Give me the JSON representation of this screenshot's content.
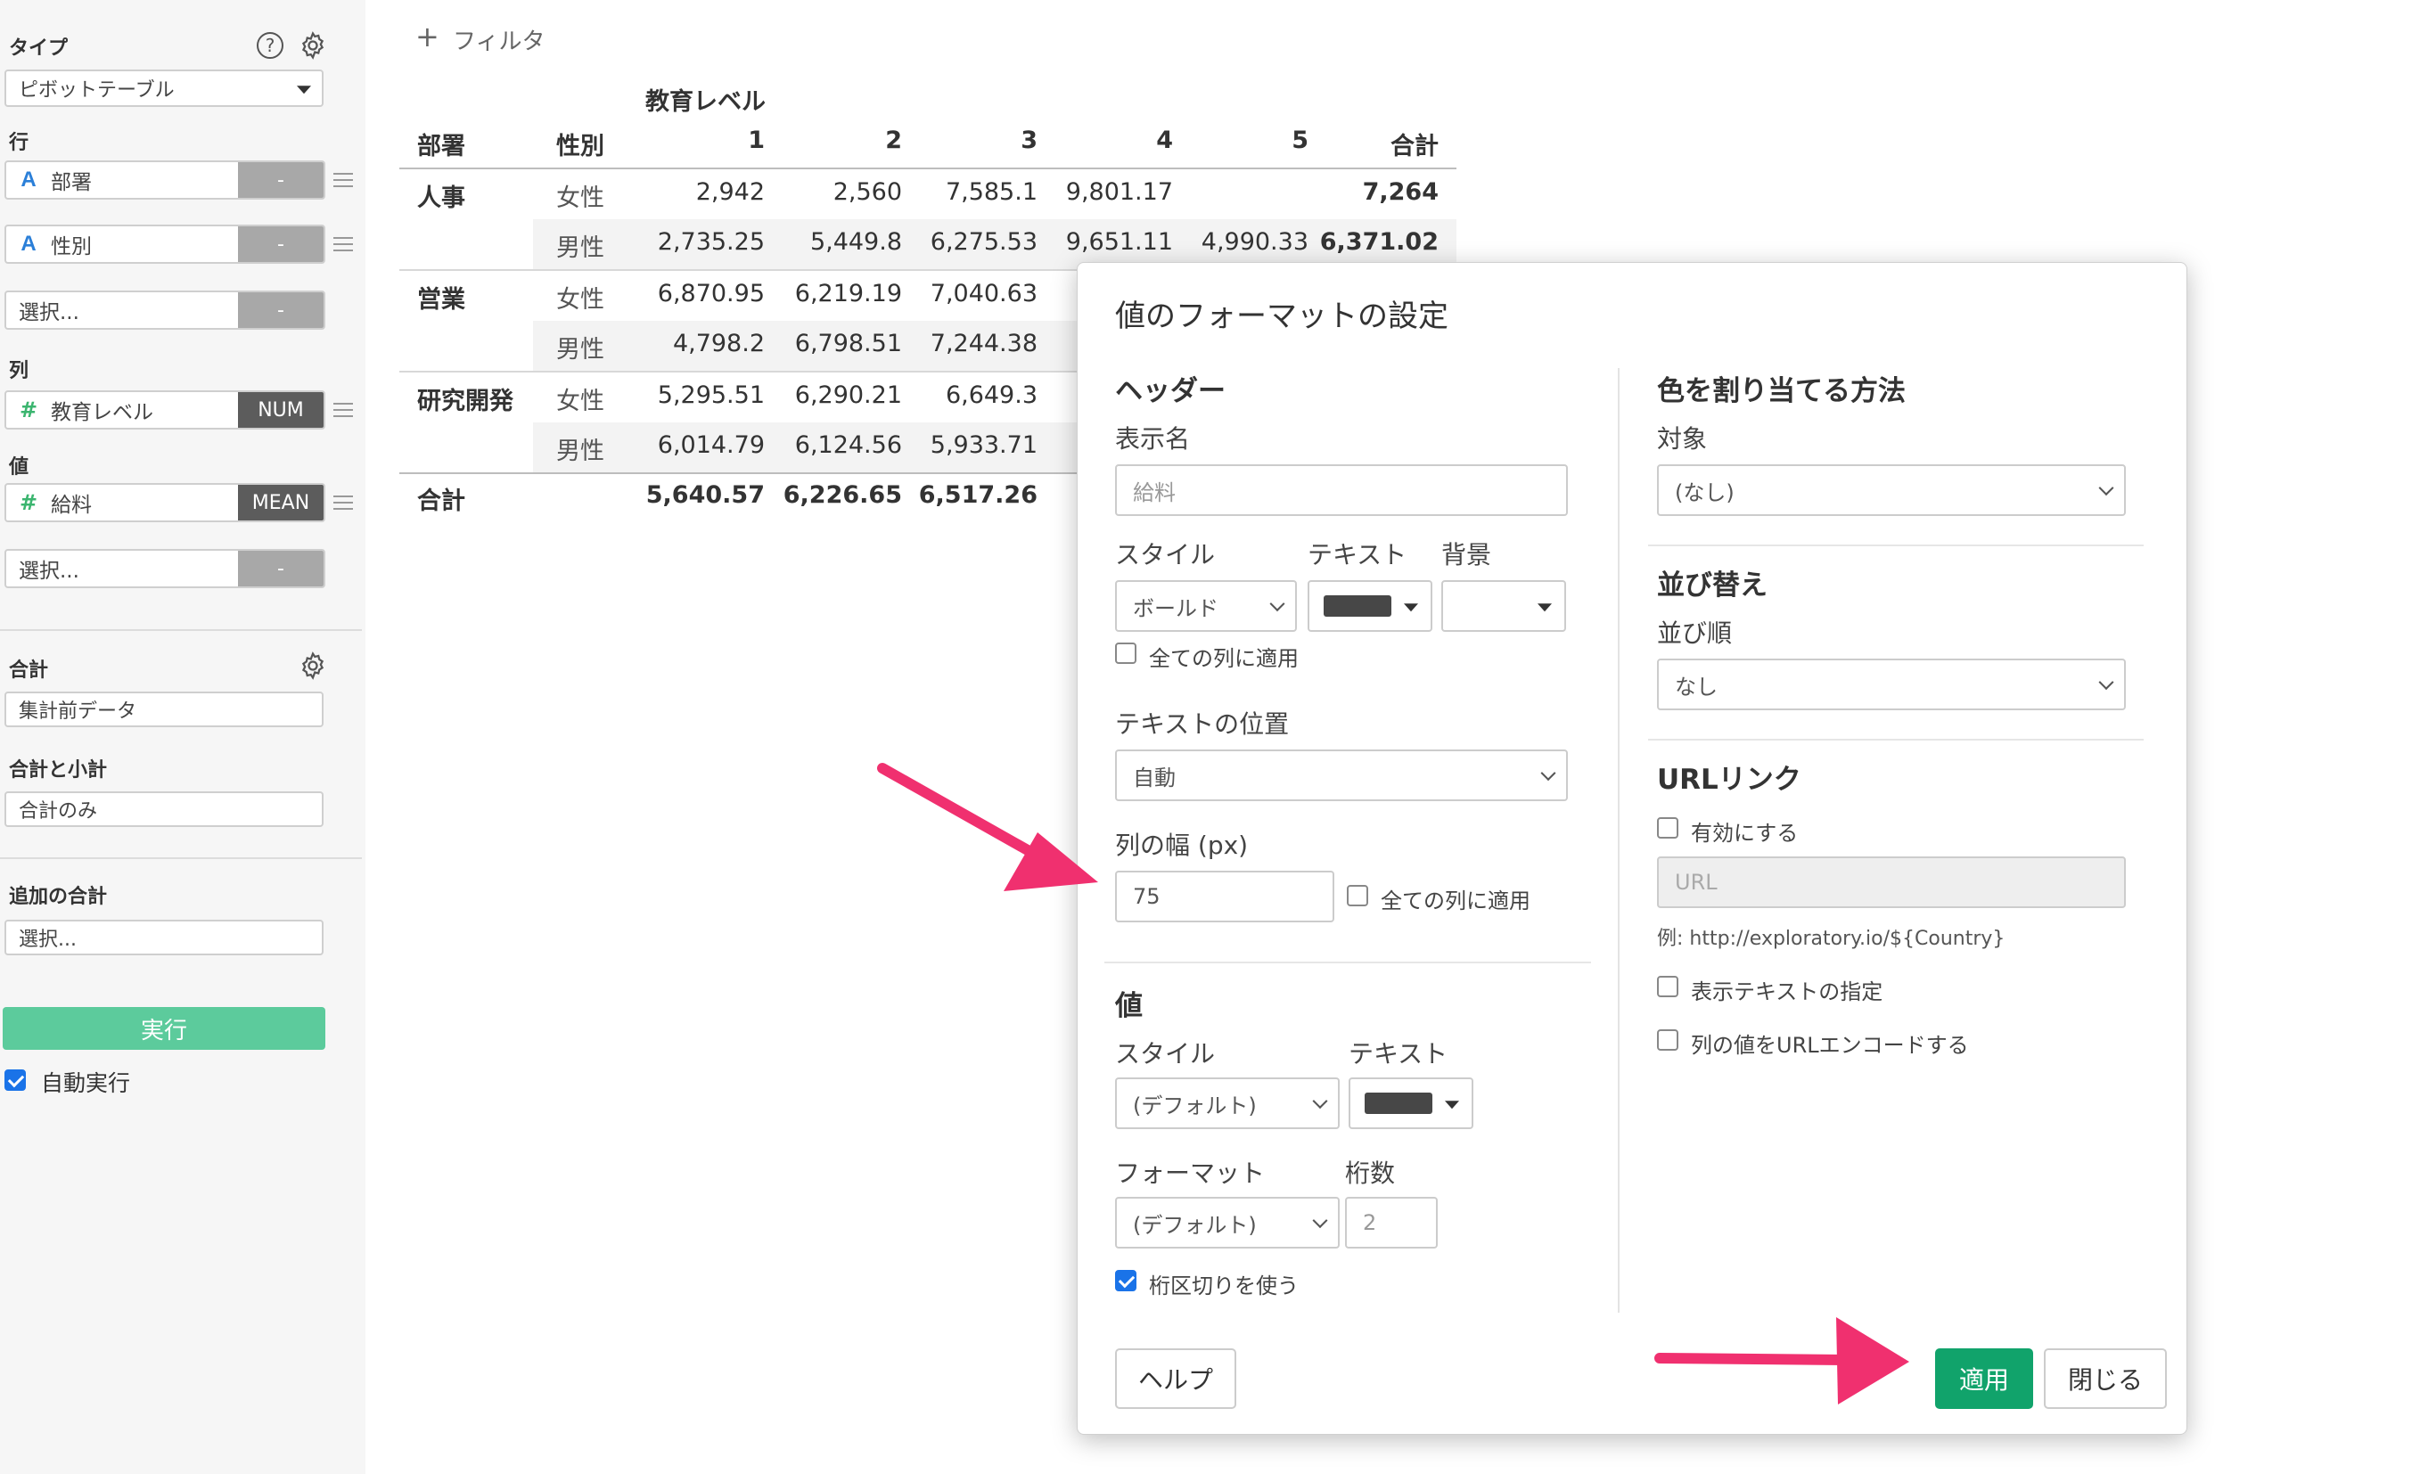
{
  "colors": {
    "accent_green": "#11a36b",
    "run_button": "#5ccb9c",
    "arrow": "#f0306f",
    "checkbox_blue": "#1a73e8"
  },
  "sidebar": {
    "type_label": "タイプ",
    "type_value": "ピボットテーブル",
    "rows_label": "行",
    "rows": [
      {
        "icon": "A",
        "name": "部署",
        "agg": "-"
      },
      {
        "icon": "A",
        "name": "性別",
        "agg": "-"
      }
    ],
    "rows_select": "選択...",
    "rows_select_agg": "-",
    "cols_label": "列",
    "col_field": {
      "icon": "#",
      "name": "教育レベル",
      "agg": "NUM"
    },
    "values_label": "値",
    "value_field": {
      "icon": "#",
      "name": "給料",
      "agg": "MEAN"
    },
    "values_select": "選択...",
    "values_select_agg": "-",
    "total_label": "合計",
    "total_value": "集計前データ",
    "subtotal_label": "合計と小計",
    "subtotal_value": "合計のみ",
    "extra_total_label": "追加の合計",
    "extra_total_value": "選択...",
    "run_label": "実行",
    "auto_run_label": "自動実行",
    "auto_run_checked": true
  },
  "filter_label": "フィルタ",
  "pivot": {
    "col_group": "教育レベル",
    "row_headers": [
      "部署",
      "性別"
    ],
    "col_headers": [
      "1",
      "2",
      "3",
      "4",
      "5",
      "合計"
    ],
    "rows": [
      {
        "dept": "人事",
        "gender": "女性",
        "cells": [
          "2,942",
          "2,560",
          "7,585.1",
          "9,801.17",
          "",
          "7,264"
        ]
      },
      {
        "dept": "",
        "gender": "男性",
        "cells": [
          "2,735.25",
          "5,449.8",
          "6,275.53",
          "9,651.11",
          "4,990.33",
          "6,371.02"
        ]
      },
      {
        "dept": "営業",
        "gender": "女性",
        "cells": [
          "6,870.95",
          "6,219.19",
          "7,040.63"
        ]
      },
      {
        "dept": "",
        "gender": "男性",
        "cells": [
          "4,798.2",
          "6,798.51",
          "7,244.38"
        ]
      },
      {
        "dept": "研究開発",
        "gender": "女性",
        "cells": [
          "5,295.51",
          "6,290.21",
          "6,649.3"
        ]
      },
      {
        "dept": "",
        "gender": "男性",
        "cells": [
          "6,014.79",
          "6,124.56",
          "5,933.71"
        ]
      }
    ],
    "total_label": "合計",
    "total_cells": [
      "5,640.57",
      "6,226.65",
      "6,517.26"
    ]
  },
  "dialog": {
    "title": "値のフォーマットの設定",
    "header_section": "ヘッダー",
    "display_name_label": "表示名",
    "display_name_placeholder": "給料",
    "style_label": "スタイル",
    "text_label": "テキスト",
    "bg_label": "背景",
    "style_value": "ボールド",
    "apply_all_cols": "全ての列に適用",
    "text_pos_label": "テキストの位置",
    "text_pos_value": "自動",
    "col_width_label": "列の幅 (px)",
    "col_width_value": "75",
    "col_width_apply_all": "全ての列に適用",
    "value_section": "値",
    "value_style_label": "スタイル",
    "value_text_label": "テキスト",
    "value_style_value": "(デフォルト)",
    "format_label": "フォーマット",
    "digits_label": "桁数",
    "format_value": "(デフォルト)",
    "digits_placeholder": "2",
    "use_separator": "桁区切りを使う",
    "use_separator_checked": true,
    "color_section": "色を割り当てる方法",
    "target_label": "対象",
    "target_value": "(なし)",
    "sort_section": "並び替え",
    "sort_order_label": "並び順",
    "sort_order_value": "なし",
    "url_section": "URLリンク",
    "enable_label": "有効にする",
    "url_placeholder": "URL",
    "url_example": "例: http://exploratory.io/${Country}",
    "display_text_label": "表示テキストの指定",
    "url_encode_label": "列の値をURLエンコードする",
    "help_button": "ヘルプ",
    "apply_button": "適用",
    "close_button": "閉じる"
  }
}
